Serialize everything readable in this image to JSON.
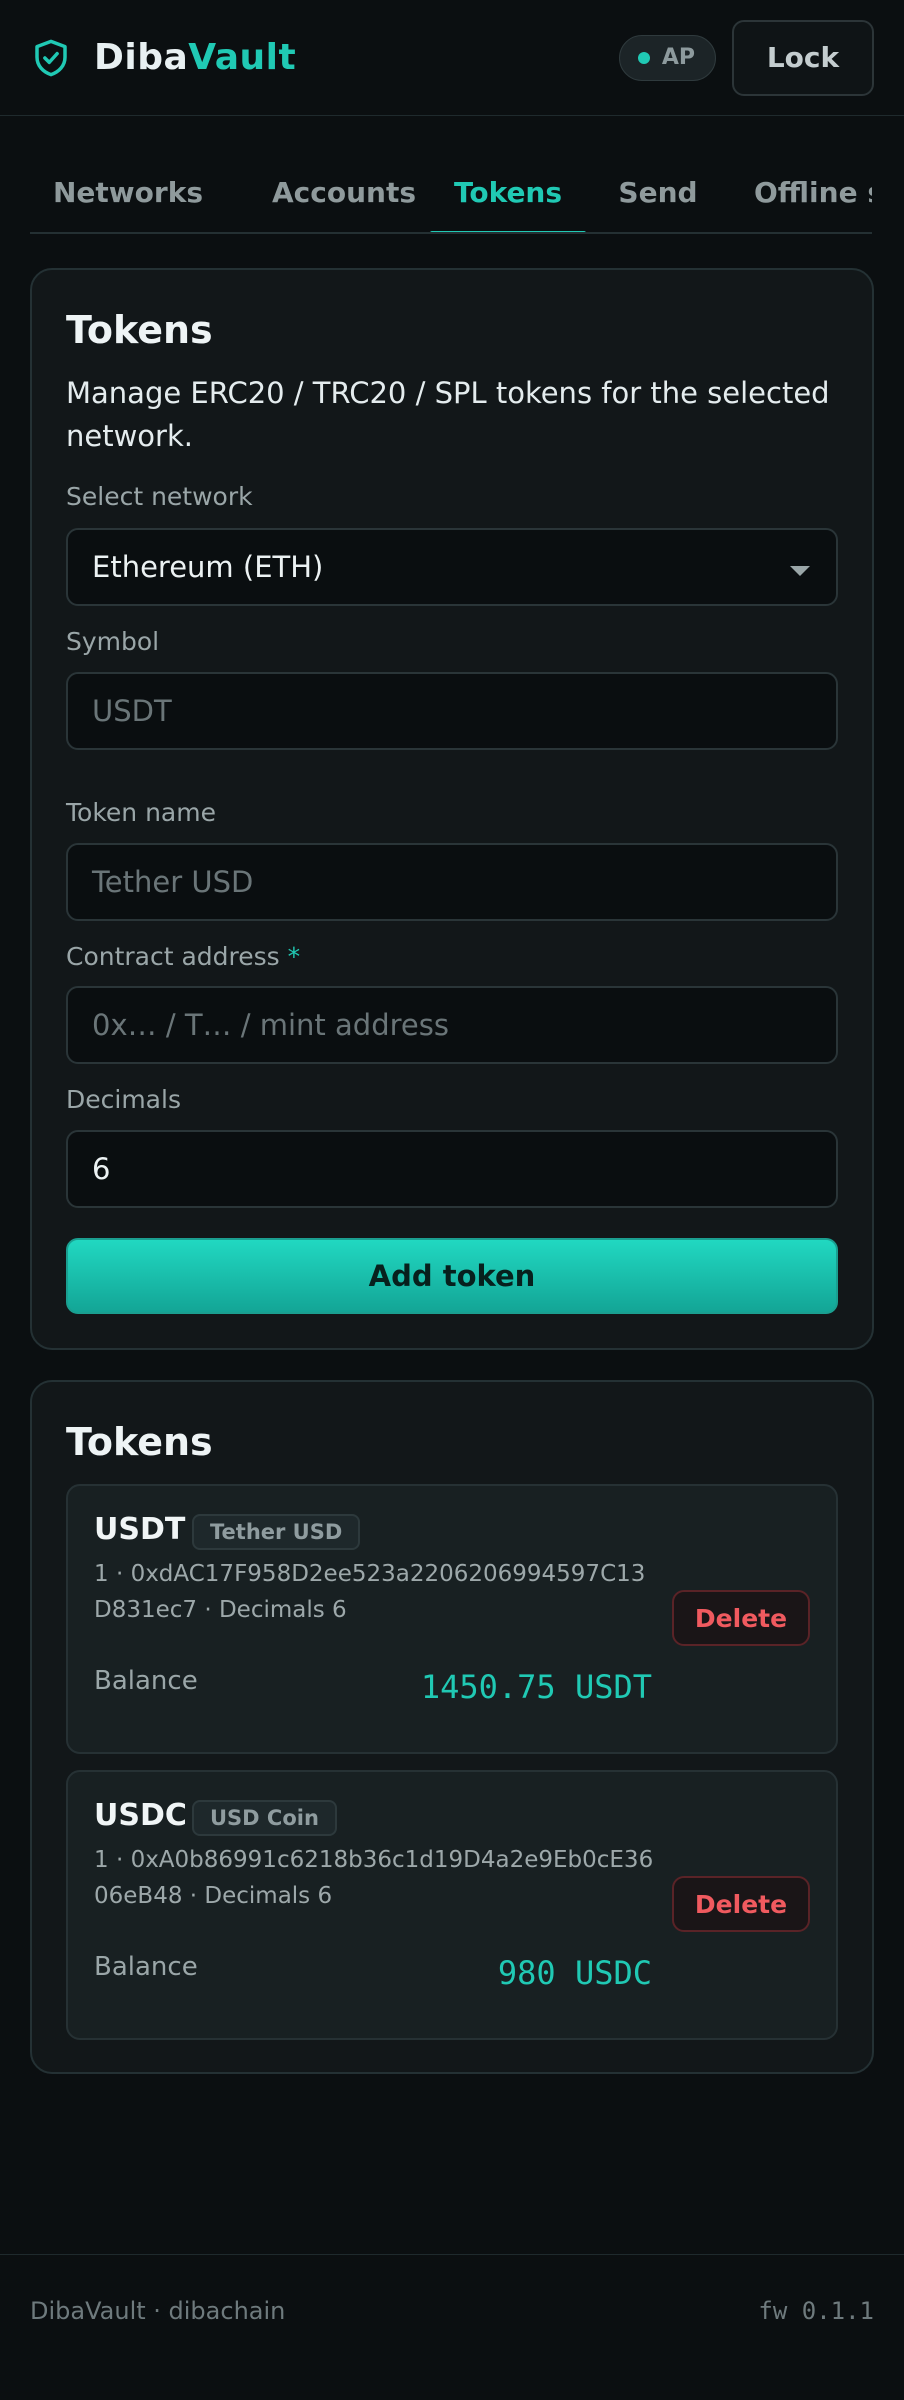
{
  "header": {
    "brand_part1": "Diba",
    "brand_part2": "Vault",
    "badge": "AP",
    "lock_label": "Lock"
  },
  "tabs": [
    {
      "label": "Networks",
      "active": false
    },
    {
      "label": "Accounts",
      "active": false
    },
    {
      "label": "Tokens",
      "active": true
    },
    {
      "label": "Send",
      "active": false
    },
    {
      "label": "Offline s",
      "active": false
    }
  ],
  "form": {
    "title": "Tokens",
    "description": "Manage ERC20 / TRC20 / SPL tokens for the selected network.",
    "network_label": "Select network",
    "network_value": "Ethereum (ETH)",
    "symbol_label": "Symbol",
    "symbol_placeholder": "USDT",
    "name_label": "Token name",
    "name_placeholder": "Tether USD",
    "contract_label": "Contract address",
    "contract_required": "*",
    "contract_placeholder": "0x… / T… / mint address",
    "decimals_label": "Decimals",
    "decimals_value": "6",
    "add_button": "Add token"
  },
  "list": {
    "title": "Tokens",
    "items": [
      {
        "symbol": "USDT",
        "name": "Tether USD",
        "details": "1 · 0xdAC17F958D2ee523a2206206994597C13D831ec7 · Decimals 6",
        "delete_label": "Delete",
        "balance_label": "Balance",
        "balance": "1450.75 USDT"
      },
      {
        "symbol": "USDC",
        "name": "USD Coin",
        "details": "1 · 0xA0b86991c6218b36c1d19D4a2e9Eb0cE3606eB48 · Decimals 6",
        "delete_label": "Delete",
        "balance_label": "Balance",
        "balance": "980 USDC"
      }
    ]
  },
  "footer": {
    "left": "DibaVault · dibachain",
    "right": "fw 0.1.1"
  },
  "colors": {
    "accent": "#20c9b4",
    "danger": "#f05a5f",
    "background": "#0b0f11"
  }
}
